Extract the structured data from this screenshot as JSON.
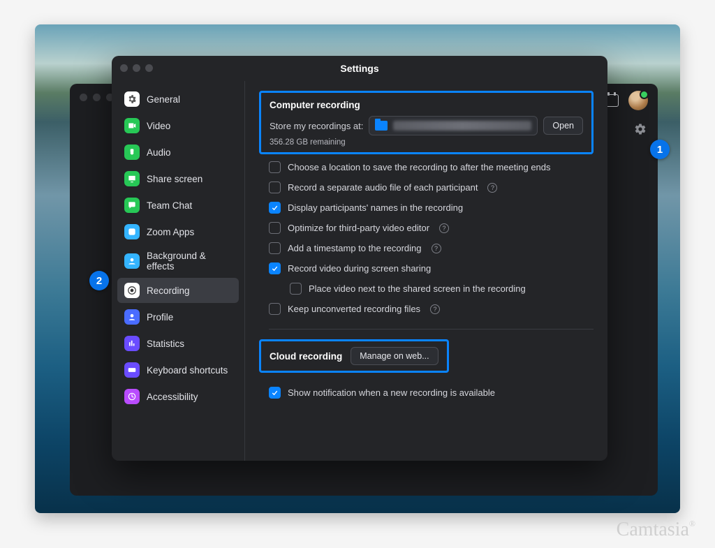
{
  "window": {
    "title": "Settings"
  },
  "sidebar": {
    "items": [
      {
        "label": "General"
      },
      {
        "label": "Video"
      },
      {
        "label": "Audio"
      },
      {
        "label": "Share screen"
      },
      {
        "label": "Team Chat"
      },
      {
        "label": "Zoom Apps"
      },
      {
        "label": "Background & effects"
      },
      {
        "label": "Recording"
      },
      {
        "label": "Profile"
      },
      {
        "label": "Statistics"
      },
      {
        "label": "Keyboard shortcuts"
      },
      {
        "label": "Accessibility"
      }
    ],
    "active_index": 7
  },
  "recording": {
    "section_title": "Computer recording",
    "store_label": "Store my recordings at:",
    "open_btn": "Open",
    "remaining": "356.28 GB remaining",
    "options": [
      {
        "label": "Choose a location to save the recording to after the meeting ends",
        "checked": false,
        "help": false
      },
      {
        "label": "Record a separate audio file of each participant",
        "checked": false,
        "help": true
      },
      {
        "label": "Display participants' names in the recording",
        "checked": true,
        "help": false
      },
      {
        "label": "Optimize for third-party video editor",
        "checked": false,
        "help": true
      },
      {
        "label": "Add a timestamp to the recording",
        "checked": false,
        "help": true
      },
      {
        "label": "Record video during screen sharing",
        "checked": true,
        "help": false
      },
      {
        "label": "Place video next to the shared screen in the recording",
        "checked": false,
        "help": false,
        "indent": true
      },
      {
        "label": "Keep unconverted recording files",
        "checked": false,
        "help": true
      }
    ],
    "cloud_title": "Cloud recording",
    "cloud_btn": "Manage on web...",
    "notify": {
      "label": "Show notification when a new recording is available",
      "checked": true
    }
  },
  "annotations": {
    "step1": "1",
    "step2": "2"
  },
  "watermark": "Camtasia"
}
